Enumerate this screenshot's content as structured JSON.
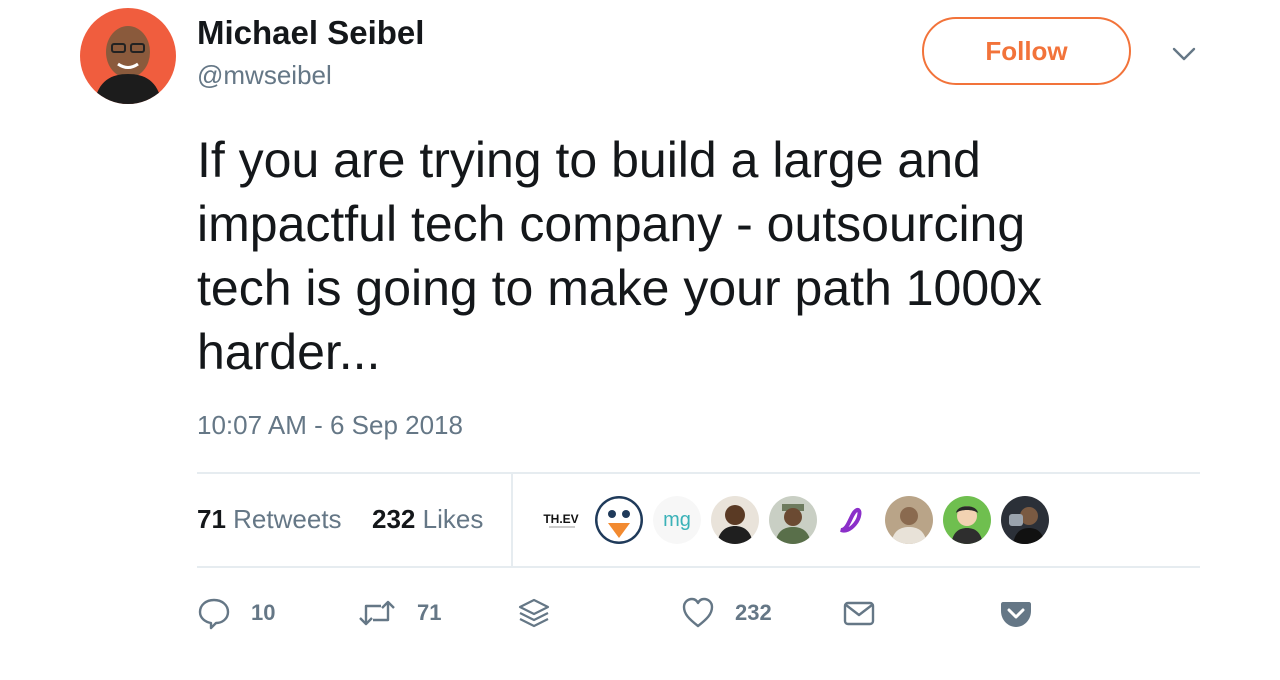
{
  "author": {
    "name": "Michael Seibel",
    "handle": "@mwseibel"
  },
  "follow_label": "Follow",
  "tweet": {
    "text": "If you are trying to build a large and\nimpactful tech company - outsourcing\ntech is going to make your path 1000x\nharder...",
    "timestamp": "10:07 AM - 6 Sep 2018"
  },
  "stats": {
    "retweets_count": "71",
    "retweets_label": "Retweets",
    "likes_count": "232",
    "likes_label": "Likes"
  },
  "likers": [
    {
      "icon": "theev-logo",
      "text": "TH.EV"
    },
    {
      "icon": "mascot-avatar"
    },
    {
      "icon": "mg-logo",
      "text": "mg"
    },
    {
      "icon": "person-avatar"
    },
    {
      "icon": "person-avatar"
    },
    {
      "icon": "purple-logo"
    },
    {
      "icon": "person-avatar"
    },
    {
      "icon": "cartoon-avatar"
    },
    {
      "icon": "person-avatar"
    }
  ],
  "actions": {
    "reply_count": "10",
    "retweet_count": "71",
    "like_count": "232"
  },
  "colors": {
    "accent": "#f2733a",
    "text": "#14171a",
    "secondary": "#657786",
    "divider": "#e6ecf0"
  }
}
